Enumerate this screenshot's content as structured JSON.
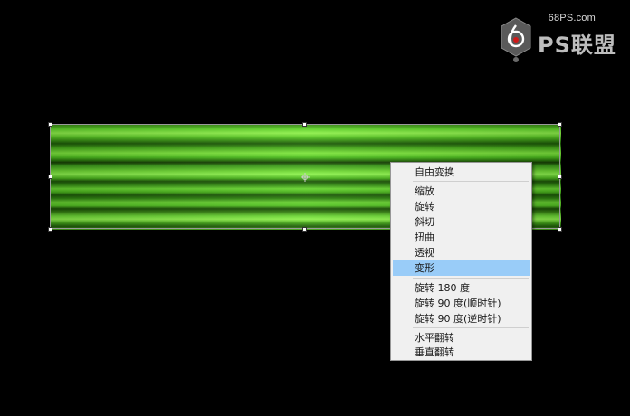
{
  "watermark": {
    "url": "68PS.com",
    "brand": "PS联盟"
  },
  "colors": {
    "menu_bg": "#f0f0f0",
    "menu_highlight": "#99ccf8",
    "layer_green": "#5fd12a"
  },
  "context_menu": {
    "groups": [
      [
        {
          "label": "自由变换"
        }
      ],
      [
        {
          "label": "缩放"
        },
        {
          "label": "旋转"
        },
        {
          "label": "斜切"
        },
        {
          "label": "扭曲"
        },
        {
          "label": "透视"
        },
        {
          "label": "变形",
          "highlighted": true
        }
      ],
      [
        {
          "label": "旋转 180 度"
        },
        {
          "label": "旋转 90 度(顺时针)"
        },
        {
          "label": "旋转 90 度(逆时针)"
        }
      ],
      [
        {
          "label": "水平翻转"
        },
        {
          "label": "垂直翻转"
        }
      ]
    ]
  }
}
